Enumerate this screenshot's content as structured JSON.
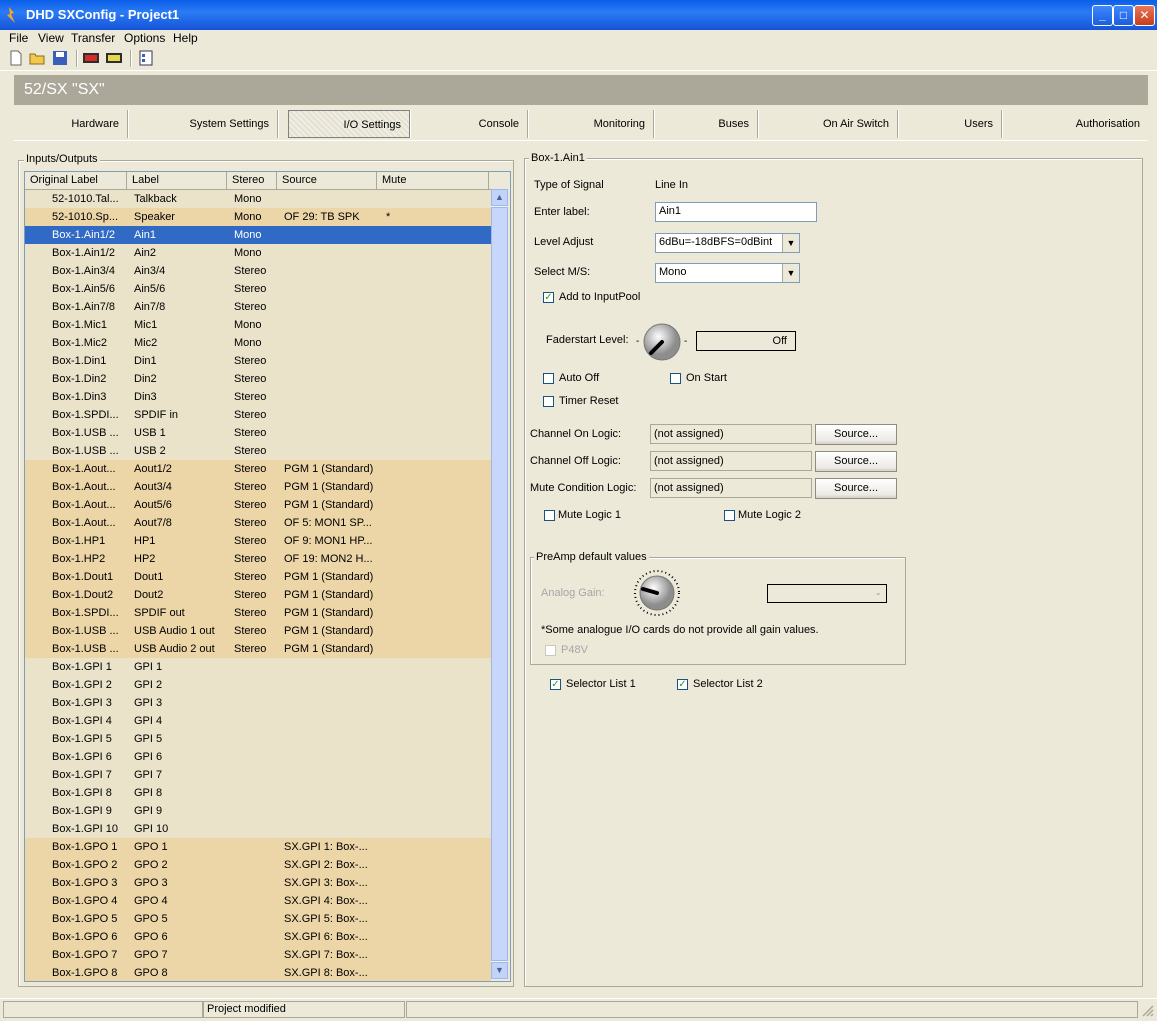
{
  "window": {
    "title": "DHD SXConfig - Project1"
  },
  "menu": [
    "File",
    "View",
    "Transfer",
    "Options",
    "Help"
  ],
  "header": {
    "device_title": "52/SX \"SX\""
  },
  "tabs": [
    "Hardware",
    "System Settings",
    "I/O Settings",
    "Console",
    "Monitoring",
    "Buses",
    "On Air Switch",
    "Users",
    "Authorisation"
  ],
  "io_list": {
    "group_label": "Inputs/Outputs",
    "columns": [
      "Original Label",
      "Label",
      "Stereo",
      "Source",
      "Mute"
    ],
    "rows": [
      {
        "orig": "52-1010.Tal...",
        "label": "Talkback",
        "stereo": "Mono",
        "source": "",
        "mute": "",
        "style": "beige"
      },
      {
        "orig": "52-1010.Sp...",
        "label": "Speaker",
        "stereo": "Mono",
        "source": "OF 29: TB SPK",
        "mute": "*",
        "style": "tan"
      },
      {
        "orig": "Box-1.Ain1/2",
        "label": "Ain1",
        "stereo": "Mono",
        "source": "",
        "mute": "",
        "style": "sel"
      },
      {
        "orig": "Box-1.Ain1/2",
        "label": "Ain2",
        "stereo": "Mono",
        "source": "",
        "mute": "",
        "style": "beige"
      },
      {
        "orig": "Box-1.Ain3/4",
        "label": "Ain3/4",
        "stereo": "Stereo",
        "source": "",
        "mute": "",
        "style": "beige"
      },
      {
        "orig": "Box-1.Ain5/6",
        "label": "Ain5/6",
        "stereo": "Stereo",
        "source": "",
        "mute": "",
        "style": "beige"
      },
      {
        "orig": "Box-1.Ain7/8",
        "label": "Ain7/8",
        "stereo": "Stereo",
        "source": "",
        "mute": "",
        "style": "beige"
      },
      {
        "orig": "Box-1.Mic1",
        "label": "Mic1",
        "stereo": "Mono",
        "source": "",
        "mute": "",
        "style": "beige"
      },
      {
        "orig": "Box-1.Mic2",
        "label": "Mic2",
        "stereo": "Mono",
        "source": "",
        "mute": "",
        "style": "beige"
      },
      {
        "orig": "Box-1.Din1",
        "label": "Din1",
        "stereo": "Stereo",
        "source": "",
        "mute": "",
        "style": "beige"
      },
      {
        "orig": "Box-1.Din2",
        "label": "Din2",
        "stereo": "Stereo",
        "source": "",
        "mute": "",
        "style": "beige"
      },
      {
        "orig": "Box-1.Din3",
        "label": "Din3",
        "stereo": "Stereo",
        "source": "",
        "mute": "",
        "style": "beige"
      },
      {
        "orig": "Box-1.SPDI...",
        "label": "SPDIF in",
        "stereo": "Stereo",
        "source": "",
        "mute": "",
        "style": "beige"
      },
      {
        "orig": "Box-1.USB ...",
        "label": "USB 1",
        "stereo": "Stereo",
        "source": "",
        "mute": "",
        "style": "beige"
      },
      {
        "orig": "Box-1.USB ...",
        "label": "USB 2",
        "stereo": "Stereo",
        "source": "",
        "mute": "",
        "style": "beige"
      },
      {
        "orig": "Box-1.Aout...",
        "label": "Aout1/2",
        "stereo": "Stereo",
        "source": "PGM 1 (Standard)",
        "mute": "",
        "style": "tan"
      },
      {
        "orig": "Box-1.Aout...",
        "label": "Aout3/4",
        "stereo": "Stereo",
        "source": "PGM 1 (Standard)",
        "mute": "",
        "style": "tan"
      },
      {
        "orig": "Box-1.Aout...",
        "label": "Aout5/6",
        "stereo": "Stereo",
        "source": "PGM 1 (Standard)",
        "mute": "",
        "style": "tan"
      },
      {
        "orig": "Box-1.Aout...",
        "label": "Aout7/8",
        "stereo": "Stereo",
        "source": "OF 5: MON1 SP...",
        "mute": "",
        "style": "tan"
      },
      {
        "orig": "Box-1.HP1",
        "label": "HP1",
        "stereo": "Stereo",
        "source": "OF 9: MON1 HP...",
        "mute": "",
        "style": "tan"
      },
      {
        "orig": "Box-1.HP2",
        "label": "HP2",
        "stereo": "Stereo",
        "source": "OF 19: MON2 H...",
        "mute": "",
        "style": "tan"
      },
      {
        "orig": "Box-1.Dout1",
        "label": "Dout1",
        "stereo": "Stereo",
        "source": "PGM 1 (Standard)",
        "mute": "",
        "style": "tan"
      },
      {
        "orig": "Box-1.Dout2",
        "label": "Dout2",
        "stereo": "Stereo",
        "source": "PGM 1 (Standard)",
        "mute": "",
        "style": "tan"
      },
      {
        "orig": "Box-1.SPDI...",
        "label": "SPDIF out",
        "stereo": "Stereo",
        "source": "PGM 1 (Standard)",
        "mute": "",
        "style": "tan"
      },
      {
        "orig": "Box-1.USB ...",
        "label": "USB Audio 1 out",
        "stereo": "Stereo",
        "source": "PGM 1 (Standard)",
        "mute": "",
        "style": "tan"
      },
      {
        "orig": "Box-1.USB ...",
        "label": "USB Audio 2 out",
        "stereo": "Stereo",
        "source": "PGM 1 (Standard)",
        "mute": "",
        "style": "tan"
      },
      {
        "orig": "Box-1.GPI 1",
        "label": "GPI 1",
        "stereo": "",
        "source": "",
        "mute": "",
        "style": "beige"
      },
      {
        "orig": "Box-1.GPI 2",
        "label": "GPI 2",
        "stereo": "",
        "source": "",
        "mute": "",
        "style": "beige"
      },
      {
        "orig": "Box-1.GPI 3",
        "label": "GPI 3",
        "stereo": "",
        "source": "",
        "mute": "",
        "style": "beige"
      },
      {
        "orig": "Box-1.GPI 4",
        "label": "GPI 4",
        "stereo": "",
        "source": "",
        "mute": "",
        "style": "beige"
      },
      {
        "orig": "Box-1.GPI 5",
        "label": "GPI 5",
        "stereo": "",
        "source": "",
        "mute": "",
        "style": "beige"
      },
      {
        "orig": "Box-1.GPI 6",
        "label": "GPI 6",
        "stereo": "",
        "source": "",
        "mute": "",
        "style": "beige"
      },
      {
        "orig": "Box-1.GPI 7",
        "label": "GPI 7",
        "stereo": "",
        "source": "",
        "mute": "",
        "style": "beige"
      },
      {
        "orig": "Box-1.GPI 8",
        "label": "GPI 8",
        "stereo": "",
        "source": "",
        "mute": "",
        "style": "beige"
      },
      {
        "orig": "Box-1.GPI 9",
        "label": "GPI 9",
        "stereo": "",
        "source": "",
        "mute": "",
        "style": "beige"
      },
      {
        "orig": "Box-1.GPI 10",
        "label": "GPI 10",
        "stereo": "",
        "source": "",
        "mute": "",
        "style": "beige"
      },
      {
        "orig": "Box-1.GPO 1",
        "label": "GPO 1",
        "stereo": "",
        "source": "SX.GPI 1: Box-...",
        "mute": "",
        "style": "tan"
      },
      {
        "orig": "Box-1.GPO 2",
        "label": "GPO 2",
        "stereo": "",
        "source": "SX.GPI 2: Box-...",
        "mute": "",
        "style": "tan"
      },
      {
        "orig": "Box-1.GPO 3",
        "label": "GPO 3",
        "stereo": "",
        "source": "SX.GPI 3: Box-...",
        "mute": "",
        "style": "tan"
      },
      {
        "orig": "Box-1.GPO 4",
        "label": "GPO 4",
        "stereo": "",
        "source": "SX.GPI 4: Box-...",
        "mute": "",
        "style": "tan"
      },
      {
        "orig": "Box-1.GPO 5",
        "label": "GPO 5",
        "stereo": "",
        "source": "SX.GPI 5: Box-...",
        "mute": "",
        "style": "tan"
      },
      {
        "orig": "Box-1.GPO 6",
        "label": "GPO 6",
        "stereo": "",
        "source": "SX.GPI 6: Box-...",
        "mute": "",
        "style": "tan"
      },
      {
        "orig": "Box-1.GPO 7",
        "label": "GPO 7",
        "stereo": "",
        "source": "SX.GPI 7: Box-...",
        "mute": "",
        "style": "tan"
      },
      {
        "orig": "Box-1.GPO 8",
        "label": "GPO 8",
        "stereo": "",
        "source": "SX.GPI 8: Box-...",
        "mute": "",
        "style": "tan"
      }
    ]
  },
  "detail": {
    "group_label": "Box-1.Ain1",
    "type_of_signal_label": "Type of Signal",
    "type_of_signal_value": "Line In",
    "enter_label_label": "Enter label:",
    "enter_label_value": "Ain1",
    "level_adjust_label": "Level Adjust",
    "level_adjust_value": "6dBu=-18dBFS=0dBint",
    "select_ms_label": "Select M/S:",
    "select_ms_value": "Mono",
    "add_to_inputpool_label": "Add to InputPool",
    "faderstart_label": "Faderstart Level:",
    "faderstart_value": "Off",
    "auto_off_label": "Auto Off",
    "on_start_label": "On Start",
    "timer_reset_label": "Timer Reset",
    "channel_on_logic_label": "Channel On Logic:",
    "channel_on_logic_value": "(not assigned)",
    "channel_off_logic_label": "Channel Off Logic:",
    "channel_off_logic_value": "(not assigned)",
    "mute_condition_logic_label": "Mute Condition Logic:",
    "mute_condition_logic_value": "(not assigned)",
    "source_button_label": "Source...",
    "mute_logic_1_label": "Mute Logic 1",
    "mute_logic_2_label": "Mute Logic 2",
    "preamp_group_label": "PreAmp default values",
    "analog_gain_label": "Analog Gain:",
    "analog_gain_value": "-",
    "preamp_note": "*Some analogue I/O cards do not provide all gain values.",
    "p48v_label": "P48V",
    "selector_list_1_label": "Selector List 1",
    "selector_list_2_label": "Selector List 2"
  },
  "status": {
    "text": "Project modified"
  },
  "colors": {
    "row_tan": "#ecd5a7",
    "row_beige": "#eae3c9",
    "selection": "#316ac5",
    "header_bar": "#aca899"
  }
}
